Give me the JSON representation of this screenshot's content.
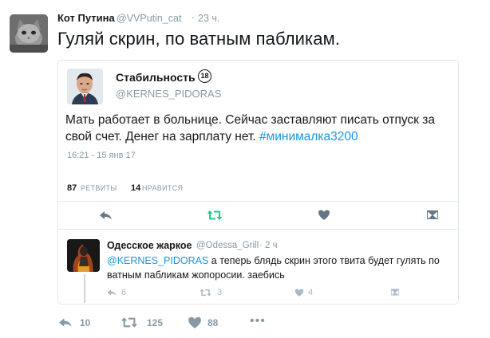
{
  "outer_tweet": {
    "name": "Кот Путина",
    "handle": "@VVPutin_cat",
    "dot": "·",
    "time": "23 ч.",
    "text": "Гуляй скрин, по ватным пабликам.",
    "actions": {
      "reply_count": "10",
      "retweet_count": "125",
      "like_count": "88",
      "more": "•••"
    }
  },
  "quoted_tweet": {
    "name": "Стабильность",
    "badge": "18",
    "handle": "@KERNES_PIDORAS",
    "text_plain": "Мать работает в больнице. Сейчас заставляют писать отпуск за свой счет. Денег на зарплату нет. ",
    "hashtag": "#минималка3200",
    "timestamp": "16:21 - 15 янв 17",
    "retweets_num": "87",
    "retweets_label": "РЕТВИТЫ",
    "likes_num": "14",
    "likes_label": "НРАВИТСЯ"
  },
  "reply": {
    "name": "Одесское жаркое",
    "handle": "@Odessa_Grill",
    "time": "· 2 ч",
    "mention": "@KERNES_PIDORAS",
    "text": " а теперь блядь скрин этого твита будет гулять по ватным пабликам жопоросии. заебись",
    "reply_count": "6",
    "retweet_count": "3",
    "like_count": "4"
  },
  "icons": {
    "reply": "reply-icon",
    "retweet": "retweet-icon",
    "like": "heart-icon",
    "dm": "envelope-icon",
    "more": "more-icon"
  },
  "colors": {
    "link": "#1b95e0",
    "retweet_active": "#19cf86",
    "muted": "#8899a6"
  }
}
